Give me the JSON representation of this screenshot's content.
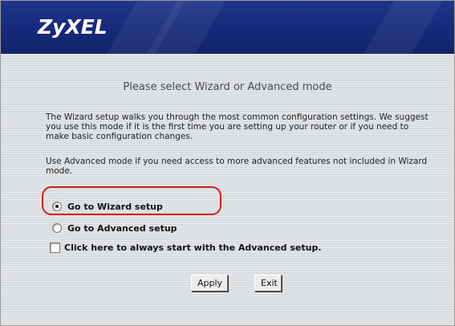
{
  "brand": {
    "logo_text": "ZyXEL"
  },
  "main": {
    "title": "Please select Wizard or Advanced mode",
    "paragraph1": "The Wizard setup walks you through the most common configuration settings. We suggest you use this mode if it is the first time you are setting up your router or if you need to make basic configuration changes.",
    "paragraph2": "Use Advanced mode if you need access to more advanced features not included in Wizard mode."
  },
  "options": [
    {
      "label": "Go to Wizard setup",
      "selected": true
    },
    {
      "label": "Go to Advanced setup",
      "selected": false
    }
  ],
  "checkbox": {
    "label": "Click here to always start with the Advanced setup.",
    "checked": false
  },
  "buttons": {
    "apply_label": "Apply",
    "exit_label": "Exit"
  },
  "colors": {
    "header_blue": "#17297a",
    "highlight_red": "#d21d1d",
    "panel_gray": "#d9dcdf"
  }
}
